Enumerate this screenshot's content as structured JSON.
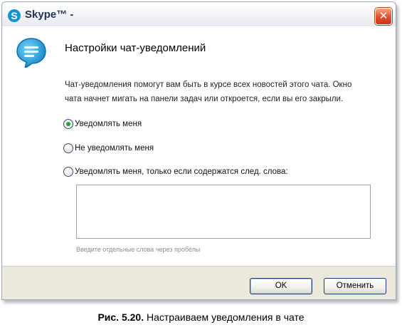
{
  "window": {
    "title": "Skype™ -",
    "logo_letter": "S",
    "close_glyph": "✕"
  },
  "header": {
    "icon": "chat-bubble-icon",
    "title": "Настройки чат-уведомлений"
  },
  "description": "Чат-уведомления помогут вам быть в курсе всех новостей этого чата. Окно чата начнет мигать на панели задач или откроется, если вы его закрыли.",
  "options": [
    {
      "label": "Уведомлять меня",
      "checked": true
    },
    {
      "label": "Не уведомлять меня",
      "checked": false
    },
    {
      "label": "Уведомлять меня, только если содержатся след. слова:",
      "checked": false
    }
  ],
  "keywords": {
    "value": "",
    "hint": "Введите отдельные слова через пробелы"
  },
  "buttons": {
    "ok": "OK",
    "cancel": "Отменить"
  },
  "caption": {
    "number": "Рис. 5.20.",
    "text": " Настраиваем уведомления в чате"
  },
  "colors": {
    "skype_blue": "#1493d3",
    "close_red": "#e0502b",
    "radio_green": "#2f9f2f"
  }
}
